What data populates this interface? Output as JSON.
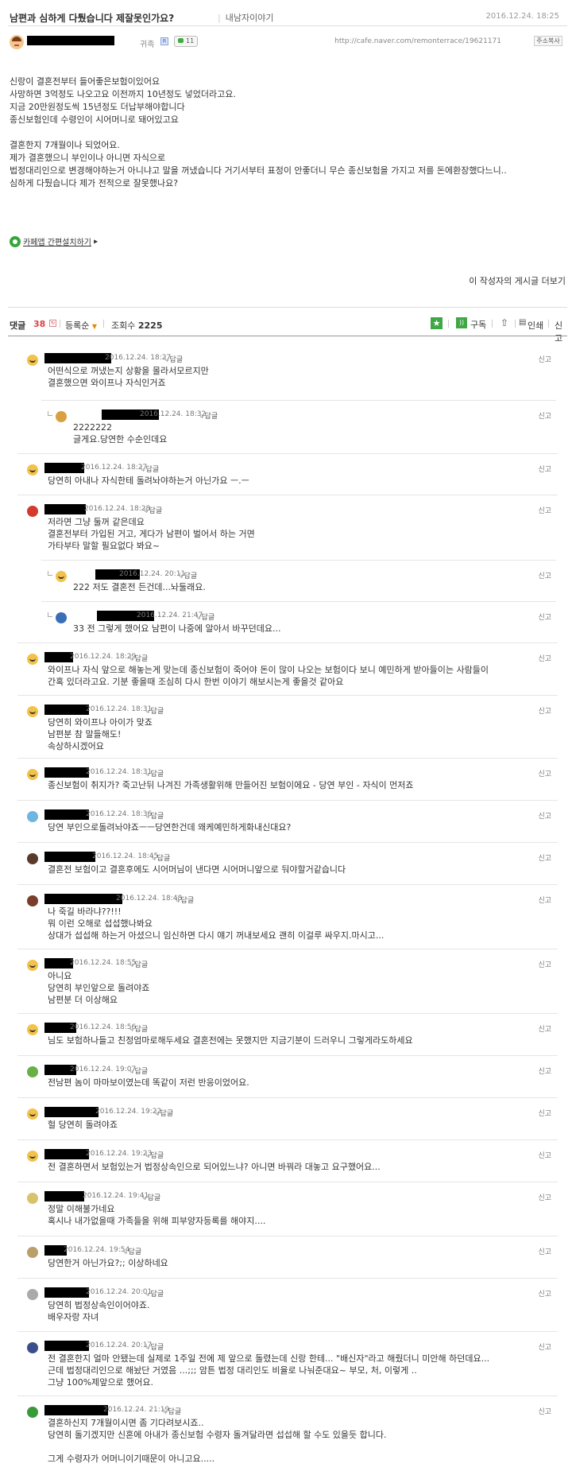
{
  "post": {
    "title": "남편과 심하게 다퉜습니다 제잘못인가요?",
    "category": "내남자이야기",
    "date": "2016.12.24. 18:25",
    "grade": "귀족",
    "reply_count": "11",
    "url": "http://cafe.naver.com/remonterrace/19621171",
    "copy_label": "주소복사",
    "body": [
      "신랑이 결혼전부터 들어좋은보험이있어요",
      "사망하면 3억정도 나오고요 이전까지 10년정도 넣었더라고요.",
      "지금 20만원정도씩 15년정도 더납부해야합니다",
      "종신보험인데 수령인이 시어머니로 돼어있고요",
      "",
      "결혼한지 7개월이나 되었어요.",
      "제가 결혼했으니 부인이나 아니면 자식으로",
      "법정대리인으로 변경해야하는거 아니냐고 말을 꺼냈습니다 거기서부터 표정이 안좋더니 무슨 종신보험을 가지고 저를 돈에환장했다느니..",
      "심하게 다퉜습니다 제가 전적으로 잘못했나요?"
    ],
    "app_link": "카페앱 간편설치하기",
    "more_posts": "이 작성자의 게시글 더보기"
  },
  "comment_bar": {
    "label": "댓글",
    "count": "38",
    "sort": "등록순",
    "views_label": "조회수",
    "views": "2225",
    "subscribe": "구독",
    "print": "인쇄",
    "report": "신고"
  },
  "comments": [
    {
      "date": "2016.12.24. 18:27",
      "reply": "답글",
      "report": "신고",
      "text": [
        "어떤식으로 꺼냈는지 상황을 몰라서모르지만",
        "결혼했으면 와이프나 자식인거죠"
      ]
    },
    {
      "date": "2016.12.24. 18:32",
      "reply": "답글",
      "report": "신고",
      "text": [
        "2222222",
        "글게요.당연한 수순인데요"
      ]
    },
    {
      "date": "2016.12.24. 18:27",
      "reply": "답글",
      "report": "신고",
      "text": [
        "당연히 아내나 자식한테 돌려놔야하는거 아닌가요 ㅡ.ㅡ"
      ]
    },
    {
      "date": "2016.12.24. 18:28",
      "reply": "답글",
      "report": "신고",
      "text": [
        "저라면 그냥 둘꺼 같은데요",
        "결혼전부터 가입된 거고, 게다가 남편이 벌어서 하는 거면",
        "가타부타 말할 필요없다 봐요~"
      ]
    },
    {
      "date": "2016.12.24. 20:11",
      "reply": "답글",
      "report": "신고",
      "text": [
        "222 저도 결혼전 든건데...놔둘래요."
      ]
    },
    {
      "date": "2016.12.24. 21:47",
      "reply": "답글",
      "report": "신고",
      "text": [
        "33 전 그렇게 했어요 남편이 나중에 알아서 바꾸던데요..."
      ]
    },
    {
      "date": "2016.12.24. 18:29",
      "reply": "답글",
      "report": "신고",
      "text": [
        "와이프나 자식 앞으로 해놓는게 맞는데 종신보험이 죽어야 돈이 많이 나오는 보험이다 보니 예민하게 받아들이는 사람들이",
        "간혹 있더라고요. 기분 좋을때 조심히 다시 한번 이야기 해보시는게 좋을것 같아요"
      ]
    },
    {
      "date": "2016.12.24. 18:31",
      "reply": "답글",
      "report": "신고",
      "text": [
        "당연히 와이프나 아이가 맞죠",
        "남편분 참 말들해도!",
        "속상하시겠어요"
      ]
    },
    {
      "date": "2016.12.24. 18:31",
      "reply": "답글",
      "report": "신고",
      "text": [
        "종신보험이 취지가? 죽고난뒤 나겨진 가족생활위해 만들어진 보험이에요 - 당연 부인 - 자식이 먼저죠"
      ]
    },
    {
      "date": "2016.12.24. 18:36",
      "reply": "답글",
      "report": "신고",
      "text": [
        "당연 부인으로돌려놔야죠ㅡㅡ당연한건데 왜케예민하게화내신대요?"
      ]
    },
    {
      "date": "2016.12.24. 18:45",
      "reply": "답글",
      "report": "신고",
      "text": [
        "결혼전 보험이고 결혼후에도 시어머님이 낸다면 시어머니앞으로 둬야할거같습니다"
      ]
    },
    {
      "date": "2016.12.24. 18:48",
      "reply": "답글",
      "report": "신고",
      "text": [
        "나 죽길 바라냐??!!!",
        "뭐 이런 오해로 섭섭했나봐요",
        "상대가 섭섭해 하는거 아셨으니 임신하면 다시 얘기 꺼내보세요 괜히 이걸루 싸우지.마시고..."
      ]
    },
    {
      "date": "2016.12.24. 18:55",
      "reply": "답글",
      "report": "신고",
      "text": [
        "아니요",
        "당연히 부인앞으로 돌려야죠",
        "남편분 더 이상해요"
      ]
    },
    {
      "date": "2016.12.24. 18:56",
      "reply": "답글",
      "report": "신고",
      "text": [
        "님도 보험하나들고 친정엄마로해두세요 결혼전에는 못했지만 지금기분이 드러우니 그렇게라도하세요"
      ]
    },
    {
      "date": "2016.12.24. 19:07",
      "reply": "답글",
      "report": "신고",
      "text": [
        "전남편 놈이 마마보이였는데 똑같이 저런 반응이었어요."
      ]
    },
    {
      "date": "2016.12.24. 19:22",
      "reply": "답글",
      "report": "신고",
      "text": [
        "헐 당연히 돌려야죠"
      ]
    },
    {
      "date": "2016.12.24. 19:23",
      "reply": "답글",
      "report": "신고",
      "text": [
        "전 결혼하면서 보험있는거 법정상속인으로 되어있느냐? 아니면 바꿔라 대놓고 요구했어요..."
      ]
    },
    {
      "date": "2016.12.24. 19:41",
      "reply": "답글",
      "report": "신고",
      "text": [
        "정말 이해불가네요",
        "혹시나 내가없을때 가족들을 위해 피부양자등록를 해야지...."
      ]
    },
    {
      "date": "2016.12.24. 19:54",
      "reply": "답글",
      "report": "신고",
      "text": [
        "당연한거 아닌가요?;; 이상하네요"
      ]
    },
    {
      "date": "2016.12.24. 20:01",
      "reply": "답글",
      "report": "신고",
      "text": [
        "당연히 법정상속인이어야죠.",
        "배우자랑 자녀"
      ]
    },
    {
      "date": "2016.12.24. 20:17",
      "reply": "답글",
      "report": "신고",
      "text": [
        "전 결혼한지 얼마 안됐는데 실제로 1주일 전에 제 앞으로 돌렸는데 신랑 한테... \"배신자\"라고 해줬더니 미안해 하던데요...",
        "근데 법정대리인으로 해놨단 거였음 ...;;; 암튼 법정 대리인도 비율로 나눠준대요~ 부모, 처, 이렇게 ..",
        "그냥 100%제앞으로 했어요."
      ]
    },
    {
      "date": "2016.12.24. 21:19",
      "reply": "답글",
      "report": "신고",
      "text": [
        "결혼하신지 7개월이시면 좀 기다려보시죠..",
        "당연히 돌기겠지만 신혼에 아내가 종신보험 수령자 돌겨달라면 섭섭해 할 수도 있을듯 합니다.",
        "",
        "그게 수령자가 어머니이기때문이 아니고요....."
      ]
    }
  ]
}
